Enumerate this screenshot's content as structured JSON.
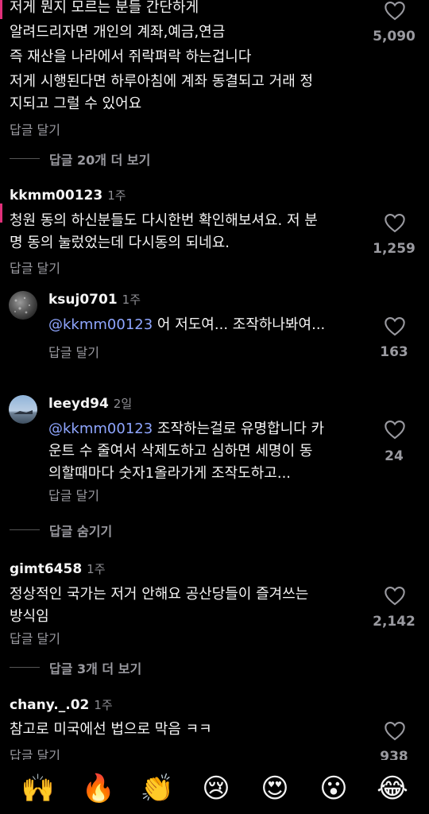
{
  "comments": [
    {
      "lines": [
        "저게 뭔지 모르는 분들 간단하게",
        "알려드리자면 개인의 계좌,예금,연금",
        "즉 재산을 나라에서 쥐락펴락 하는겁니다",
        "저게 시행된다면 하루아침에 계좌 동결되고 거래 정",
        "지되고 그럴 수 있어요"
      ],
      "reply_label": "답글 달기",
      "likes": "5,090",
      "more_replies": "답글 20개 더 보기"
    },
    {
      "username": "kkmm00123",
      "age": "1주",
      "lines": [
        "청원 동의 하신분들도 다시한번 확인해보셔요. 저 분",
        "명 동의 눌렀었는데 다시동의 되네요."
      ],
      "reply_label": "답글 달기",
      "likes": "1,259"
    },
    {
      "username": "ksuj0701",
      "age": "1주",
      "mention": "@kkmm00123",
      "lines": [
        " 어 저도여... 조작하나봐여..."
      ],
      "reply_label": "답글 달기",
      "likes": "163"
    },
    {
      "username": "leeyd94",
      "age": "2일",
      "mention": "@kkmm00123",
      "lines": [
        " 조작하는걸로 유명합니다 카",
        "운트 수 줄여서 삭제도하고 심하면 세명이 동",
        "의할때마다 숫자1올라가게 조작도하고..."
      ],
      "reply_label": "답글 달기",
      "likes": "24",
      "hide_replies": "답글 숨기기"
    },
    {
      "username": "gimt6458",
      "age": "1주",
      "lines": [
        "정상적인 국가는 저거 안해요 공산당들이 즐겨쓰는",
        "방식임"
      ],
      "reply_label": "답글 달기",
      "likes": "2,142",
      "more_replies": "답글 3개 더 보기"
    },
    {
      "username": "chany._.02",
      "age": "1주",
      "lines": [
        "참고로 미국에선 법으로 막음 ㅋㅋ"
      ],
      "reply_label": "답글 달기",
      "likes": "938"
    }
  ],
  "emoji_bar": [
    "🙌",
    "🔥",
    "👏",
    "😢",
    "😍",
    "😮",
    "😂"
  ],
  "colors": {
    "background": "#000000",
    "mention": "#8fa6ff",
    "muted": "#9a9aa0"
  }
}
